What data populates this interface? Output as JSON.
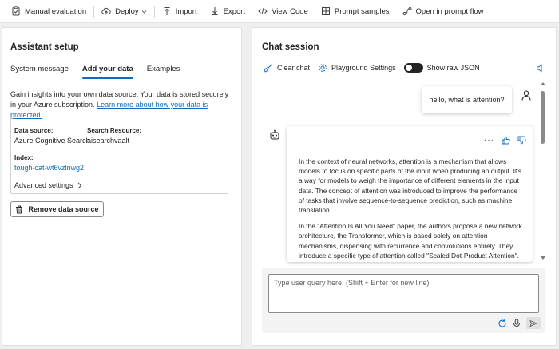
{
  "toolbar": {
    "manual_evaluation": "Manual evaluation",
    "deploy": "Deploy",
    "import": "Import",
    "export": "Export",
    "view_code": "View Code",
    "prompt_samples": "Prompt samples",
    "open_prompt_flow": "Open in prompt flow"
  },
  "assistant": {
    "title": "Assistant setup",
    "tabs": [
      {
        "label": "System message",
        "active": false
      },
      {
        "label": "Add your data",
        "active": true
      },
      {
        "label": "Examples",
        "active": false
      }
    ],
    "description": "Gain insights into your own data source. Your data is stored securely in your Azure subscription.",
    "learn_more": "Learn more about how your data is protected.",
    "data_source_label": "Data source:",
    "data_source_value": "Azure Cognitive Search",
    "search_resource_label": "Search Resource:",
    "search_resource_value": "aisearchvaalt",
    "index_label": "Index:",
    "index_value": "tough-cat-wt6vzlnwg2",
    "advanced_settings": "Advanced settings",
    "remove_button": "Remove data source"
  },
  "chat": {
    "title": "Chat session",
    "clear_chat": "Clear chat",
    "playground_settings": "Playground Settings",
    "show_raw_json": "Show raw JSON",
    "show_raw_json_on": false,
    "user_message": "hello, what is attention?",
    "bot_paragraphs": [
      "In the context of neural networks, attention is a mechanism that allows models to focus on specific parts of the input when producing an output. It's a way for models to weigh the importance of different elements in the input data. The concept of attention was introduced to improve the performance of tasks that involve sequence-to-sequence prediction, such as machine translation.",
      "In the \"Attention Is All You Need\" paper, the authors propose a new network architecture, the Transformer, which is based solely on attention mechanisms, dispensing with recurrence and convolutions entirely. They introduce a specific type of attention called \"Scaled Dot-Product Attention\". This mechanism computes the attention weights by taking the dot product of the query with all keys."
    ],
    "more_options": "···",
    "input_placeholder": "Type user query here. (Shift + Enter for new line)",
    "input_value": ""
  },
  "colors": {
    "accent": "#0f6cbd",
    "text": "#242424",
    "background": "#efefef"
  }
}
